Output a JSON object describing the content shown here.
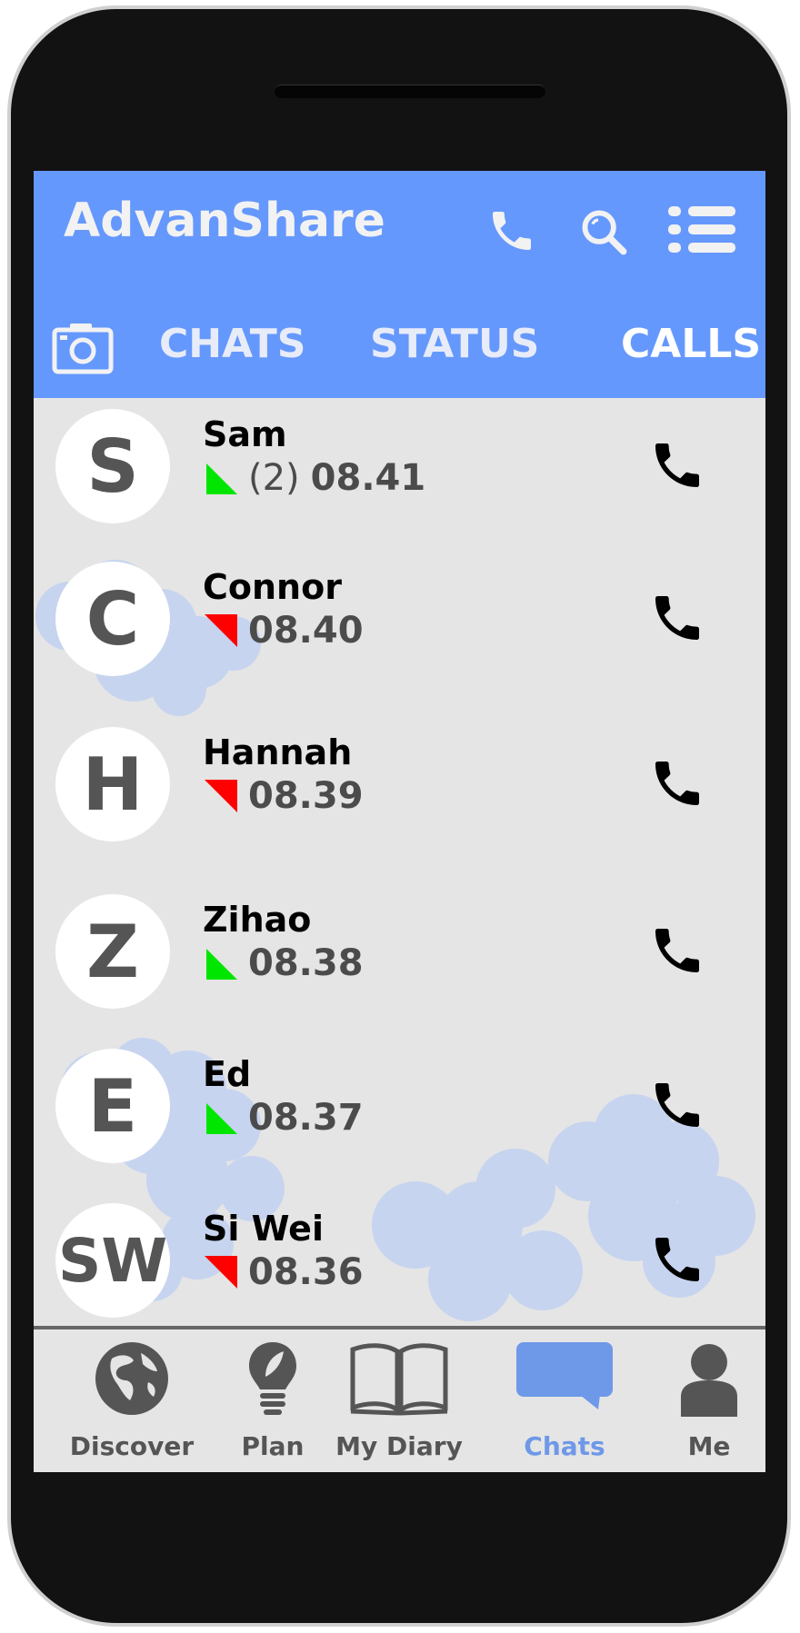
{
  "app": {
    "title": "AdvanShare",
    "accent_color": "#6598fd",
    "header_icons": [
      "phone-icon",
      "search-icon",
      "menu-list-icon"
    ]
  },
  "tabs": {
    "camera_icon": "camera-icon",
    "items": [
      {
        "label": "CHATS",
        "active": false
      },
      {
        "label": "STATUS",
        "active": false
      },
      {
        "label": "CALLS",
        "active": true
      }
    ]
  },
  "calls": [
    {
      "initial": "S",
      "name": "Sam",
      "direction": "outgoing",
      "count": "(2)",
      "time": "08.41"
    },
    {
      "initial": "C",
      "name": "Connor",
      "direction": "incoming",
      "count": "",
      "time": "08.40"
    },
    {
      "initial": "H",
      "name": "Hannah",
      "direction": "incoming",
      "count": "",
      "time": "08.39"
    },
    {
      "initial": "Z",
      "name": "Zihao",
      "direction": "outgoing",
      "count": "",
      "time": "08.38"
    },
    {
      "initial": "E",
      "name": "Ed",
      "direction": "outgoing",
      "count": "",
      "time": "08.37"
    },
    {
      "initial": "SW",
      "name": "Si Wei",
      "direction": "incoming",
      "count": "",
      "time": "08.36"
    }
  ],
  "status_colors": {
    "outgoing": "#00e600",
    "incoming": "#ff0000"
  },
  "bottom_nav": [
    {
      "label": "Discover",
      "icon": "globe-icon",
      "active": false
    },
    {
      "label": "Plan",
      "icon": "lightbulb-icon",
      "active": false
    },
    {
      "label": "My Diary",
      "icon": "book-icon",
      "active": false
    },
    {
      "label": "Chats",
      "icon": "chat-bubble-icon",
      "active": true
    },
    {
      "label": "Me",
      "icon": "person-icon",
      "active": false
    }
  ]
}
